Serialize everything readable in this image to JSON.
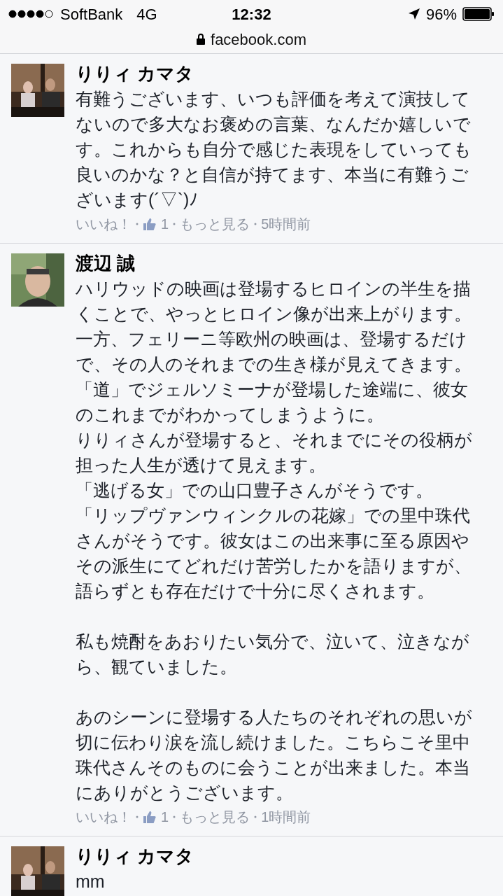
{
  "status_bar": {
    "carrier": "SoftBank",
    "network": "4G",
    "time": "12:32",
    "battery": "96%"
  },
  "address_bar": {
    "url": "facebook.com"
  },
  "comments": [
    {
      "author": "りりィ カマタ",
      "avatar": {
        "kind": "picture"
      },
      "paragraphs": [
        [
          "有難うございます、いつも評価を考えて演技して",
          "ないので多大なお褒めの言葉、なんだか嬉しいで",
          "す。これからも自分で感じた表現をしていっても",
          "良いのかな？と自信が持てます、本当に有難うご",
          "ざいます(´▽`)ﾉ"
        ]
      ],
      "like": "いいね！",
      "like_count": "1",
      "more": "もっと見る",
      "time": "5時間前"
    },
    {
      "author": "渡辺 誠",
      "avatar": {
        "kind": "picture"
      },
      "paragraphs": [
        [
          "ハリウッドの映画は登場するヒロインの半生を描",
          "くことで、やっとヒロイン像が出来上がります。",
          "一方、フェリーニ等欧州の映画は、登場するだけ",
          "で、その人のそれまでの生き様が見えてきます。",
          "「道」でジェルソミーナが登場した途端に、彼女",
          "のこれまでがわかってしまうように。",
          "りりィさんが登場すると、それまでにその役柄が",
          "担った人生が透けて見えます。",
          "「逃げる女」での山口豊子さんがそうです。",
          "「リップヴァンウィンクルの花嫁」での里中珠代",
          "さんがそうです。彼女はこの出来事に至る原因や",
          "その派生にてどれだけ苦労したかを語りますが、",
          "語らずとも存在だけで十分に尽くされます。"
        ],
        [
          "私も焼酎をあおりたい気分で、泣いて、泣きなが",
          "ら、観ていました。"
        ],
        [
          "あのシーンに登場する人たちのそれぞれの思いが",
          "切に伝わり涙を流し続けました。こちらこそ里中",
          "珠代さんそのものに会うことが出来ました。本当",
          "にありがとうございます。"
        ]
      ],
      "like": "いいね！",
      "like_count": "1",
      "more": "もっと見る",
      "time": "1時間前"
    },
    {
      "author": "りりィ カマタ",
      "avatar": {
        "kind": "picture"
      },
      "paragraphs": [
        [
          "mm"
        ]
      ]
    }
  ]
}
